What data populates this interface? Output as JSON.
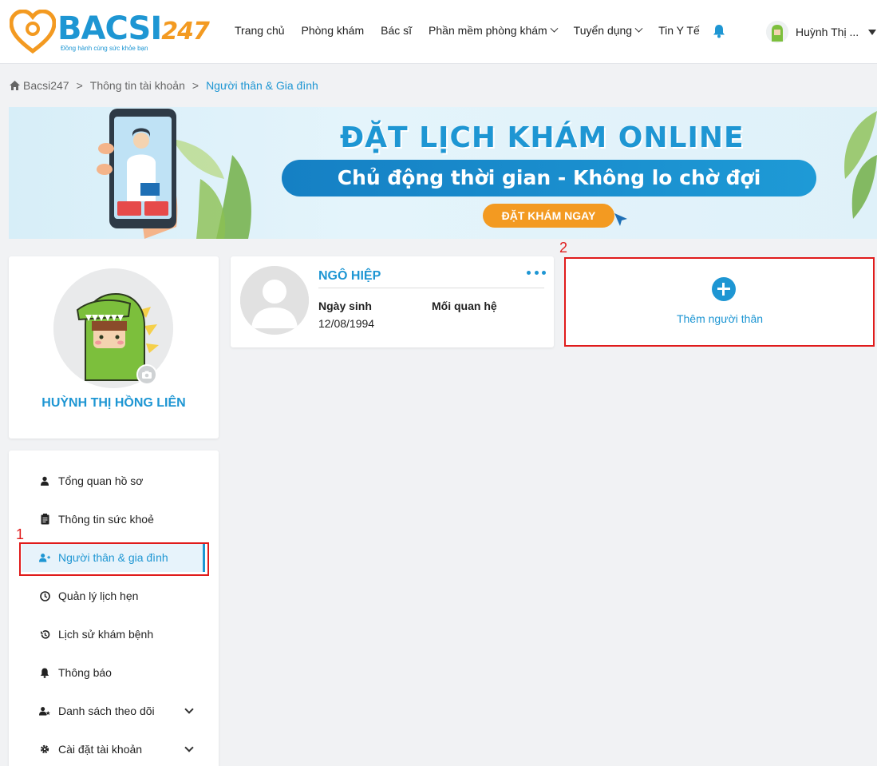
{
  "header": {
    "logo_text": "BACSI",
    "logo_number": "247",
    "logo_tagline": "Đồng hành cùng sức khỏe bạn",
    "nav": [
      {
        "label": "Trang chủ",
        "dropdown": false
      },
      {
        "label": "Phòng khám",
        "dropdown": false
      },
      {
        "label": "Bác sĩ",
        "dropdown": false
      },
      {
        "label": "Phần mềm phòng khám",
        "dropdown": true
      },
      {
        "label": "Tuyển dụng",
        "dropdown": true
      },
      {
        "label": "Tin Y Tế",
        "dropdown": false
      }
    ],
    "notification_icon": "bell-icon",
    "user_name": "Huỳnh Thị ..."
  },
  "breadcrumb": {
    "home": "Bacsi247",
    "level2": "Thông tin tài khoản",
    "current": "Người thân & Gia đình",
    "separator": ">"
  },
  "banner": {
    "title": "ĐẶT LỊCH KHÁM ONLINE",
    "subtitle": "Chủ động thời gian - Không lo chờ đợi",
    "cta": "ĐẶT KHÁM NGAY"
  },
  "profile": {
    "name": "HUỲNH THỊ HỒNG LIÊN"
  },
  "menu": {
    "items": [
      {
        "label": "Tổng quan hồ sơ",
        "icon": "user-icon"
      },
      {
        "label": "Thông tin sức khoẻ",
        "icon": "clipboard-icon"
      },
      {
        "label": "Người thân & gia đình",
        "icon": "user-plus-icon"
      },
      {
        "label": "Quản lý lịch hẹn",
        "icon": "clock-icon"
      },
      {
        "label": "Lịch sử khám bệnh",
        "icon": "history-icon"
      },
      {
        "label": "Thông báo",
        "icon": "bell-icon"
      },
      {
        "label": "Danh sách theo dõi",
        "icon": "user-star-icon"
      },
      {
        "label": "Cài đặt tài khoản",
        "icon": "gear-icon"
      }
    ]
  },
  "relative": {
    "name": "NGÔ HIỆP",
    "birth_label": "Ngày sinh",
    "birth_value": "12/08/1994",
    "relation_label": "Mối quan hệ",
    "relation_value": ""
  },
  "add_relative": {
    "label": "Thêm người thân"
  },
  "annotations": {
    "n1": "1",
    "n2": "2"
  },
  "colors": {
    "brand_blue": "#1e96d3",
    "brand_orange": "#f39a21",
    "annotation_red": "#e01b1b"
  }
}
